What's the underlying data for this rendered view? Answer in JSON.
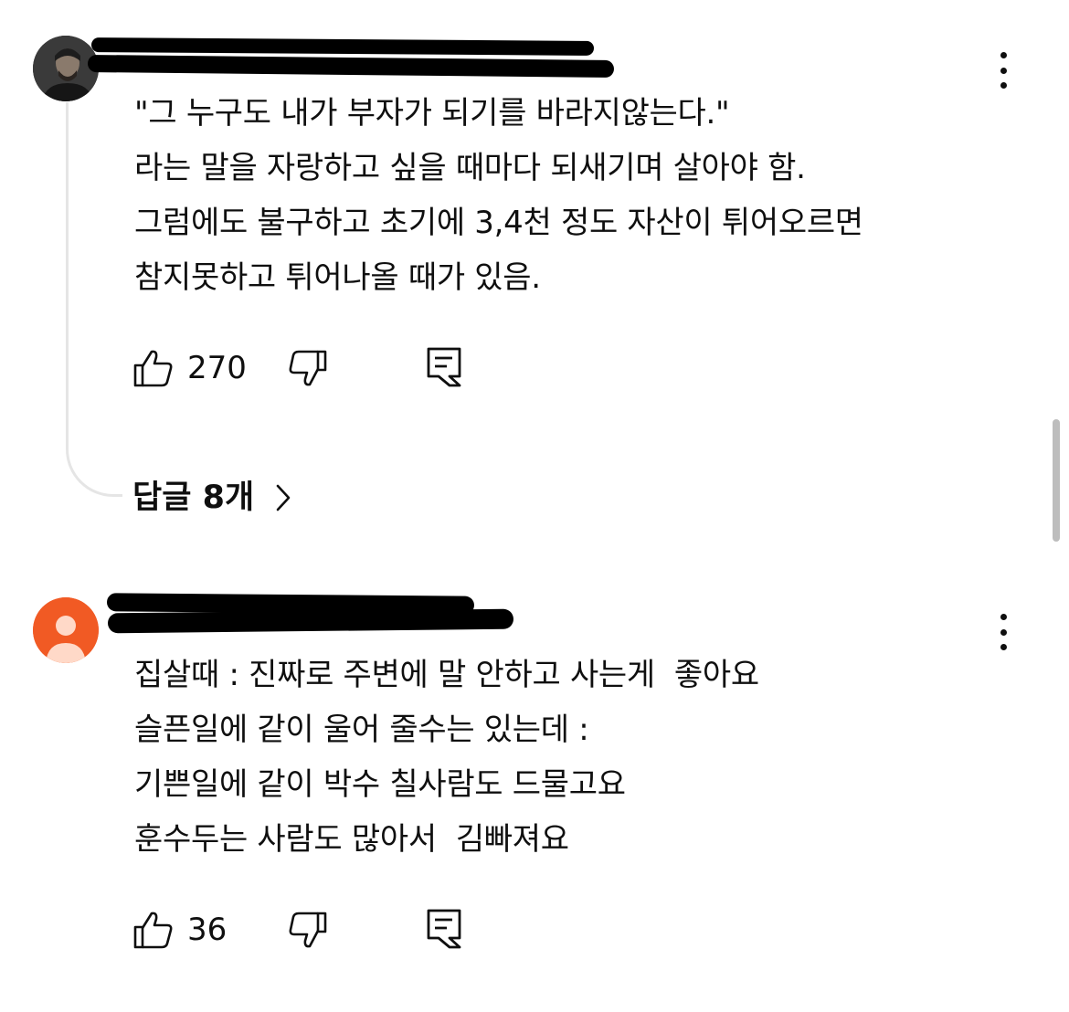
{
  "comments": [
    {
      "text": "\"그 누구도 내가 부자가 되기를 바라지않는다.\"\n라는 말을 자랑하고 싶을 때마다 되새기며 살아야 함.\n그럼에도 불구하고 초기에 3,4천 정도 자산이 튀어오르면\n참지못하고 튀어나올 때가 있음.",
      "likes": "270",
      "replies_label": "답글 8개",
      "more_icon": "more-vert-icon"
    },
    {
      "text": "집살때 : 진짜로 주변에 말 안하고 사는게  좋아요\n슬픈일에 같이 울어 줄수는 있는데 :\n기쁜일에 같이 박수 칠사람도 드물고요\n훈수두는 사람도 많아서  김빠져요",
      "likes": "36",
      "more_icon": "more-vert-icon"
    }
  ],
  "icons": {
    "like": "thumbs-up-icon",
    "dislike": "thumbs-down-icon",
    "reply": "comment-icon",
    "chevron": "chevron-right-icon"
  },
  "colors": {
    "text": "#0f0f0f",
    "thread_line": "#e5e5e5",
    "default_avatar": "#f15a24",
    "scrollbar": "#bdbdbd"
  }
}
